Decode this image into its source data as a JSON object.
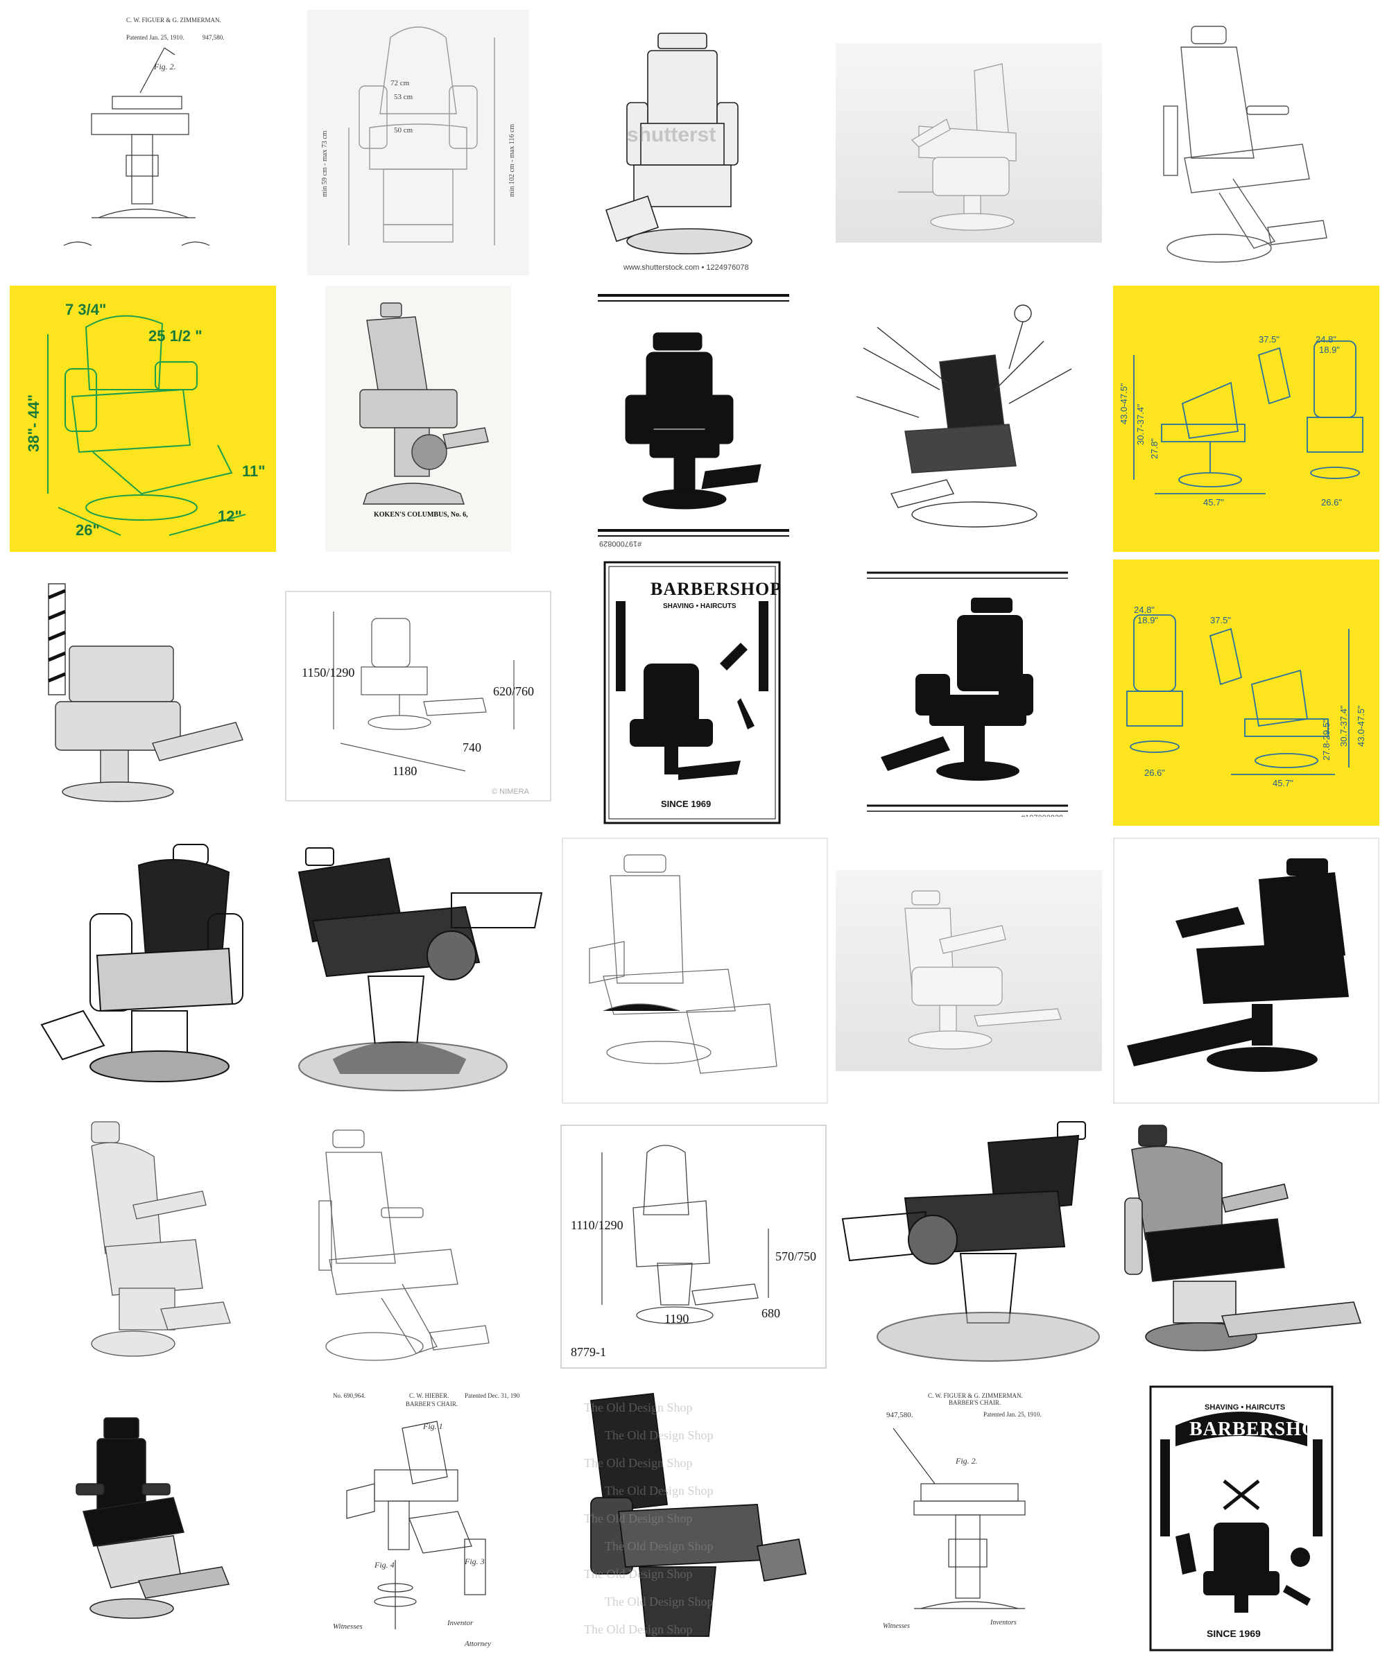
{
  "watermarks": {
    "shutterstock": "shutterst",
    "shutterstock_url": "www.shutterstock.com • 1224976078",
    "stock_id": "#197000829",
    "nimera": "© NIMERA",
    "old_design": "The Old Design Shop"
  },
  "dimensions": {
    "tile_2": {
      "width1": "72 cm",
      "width2": "53 cm",
      "depth": "50 cm",
      "h_left": "min 59 cm - max 73 cm",
      "h_right": "min 102 cm - max 116 cm"
    },
    "tile_6": {
      "d1": "7 3/4\"",
      "d2": "25 1/2 \"",
      "d3": "38\"- 44\"",
      "d4": "26\"",
      "d5": "11\"",
      "d6": "12\""
    },
    "tile_10": {
      "d1": "24.8\"",
      "d2": "18.9\"",
      "d3": "37.5\"",
      "d4": "43.0-47.5\"",
      "d5": "30.7-37.4\"",
      "d6": "27.8\"",
      "d7": "45.7\"",
      "d8": "26.6\""
    },
    "tile_12": {
      "h": "1150/1290",
      "seat": "620/760",
      "depth": "740",
      "len": "1180"
    },
    "tile_15": {
      "d1": "24.8\"",
      "d2": "18.9\"",
      "d3": "37.5\"",
      "d4": "43.0-47.5\"",
      "d5": "30.7-37.4\"",
      "d6": "27.8-29.5\"",
      "d7": "45.7\"",
      "d8": "26.6\""
    },
    "tile_23": {
      "h": "1110/1290",
      "seat": "570/750",
      "len": "1190",
      "depth": "680",
      "code": "8779-1"
    }
  },
  "posters": {
    "top_title": "BARBERSHOP",
    "ribbon": "SHAVING • HAIRCUTS",
    "since": "SINCE 1969",
    "ribbon2": "SHAVING • HAIRCUTS"
  },
  "patents": {
    "p1_header": "C. W. FIGUER & G. ZIMMERMAN.",
    "p1_num": "947,580.",
    "p1_date": "Patented Jan. 25, 1910.",
    "p1_fig": "Fig. 2.",
    "p2_num": "No. 690,964.",
    "p2_name": "C. W. HIEBER.",
    "p2_title": "BARBER'S CHAIR.",
    "p2_date": "Patented Dec. 31, 1901.",
    "p2_fig1": "Fig. 1",
    "p2_fig3": "Fig. 3",
    "p2_fig4": "Fig. 4",
    "p2_witnesses": "Witnesses",
    "p2_inventor": "Inventor",
    "p2_attorney": "Attorney",
    "p3_header": "C. W. FIGUER & G. ZIMMERMAN.",
    "p3_title": "BARBER'S CHAIR.",
    "p3_num": "947,580.",
    "p3_date": "Patented Jan. 25, 1910.",
    "p3_fig": "Fig. 2.",
    "p3_witnesses": "Witnesses",
    "p3_inventors": "Inventors"
  },
  "catalog": {
    "caption": "KOKEN'S COLUMBUS, No. 6,"
  },
  "colors": {
    "yellow": "#fce51e",
    "green_drawing": "#1e9e4a",
    "blue_drawing": "#2a6fa0",
    "ink": "#111111"
  }
}
